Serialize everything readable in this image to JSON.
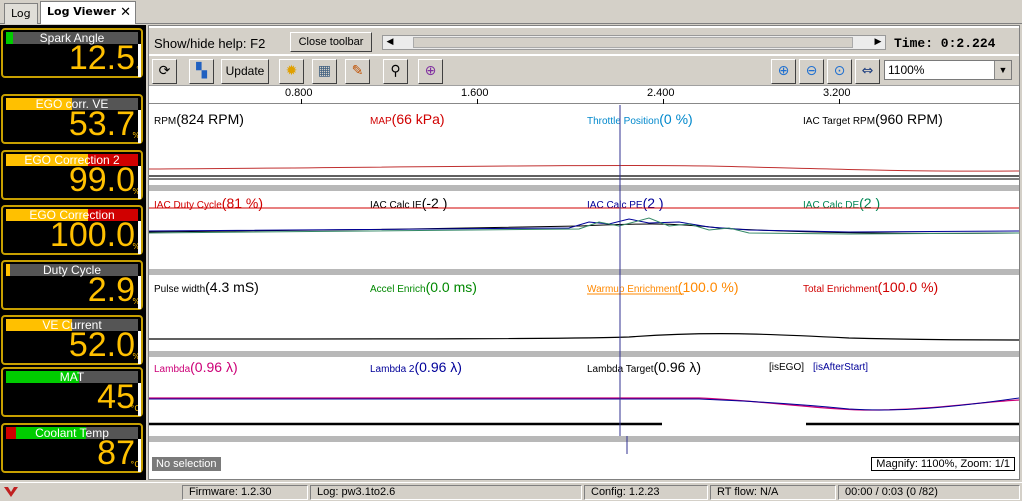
{
  "tabs": [
    {
      "label": "Log"
    },
    {
      "label": "Log Viewer",
      "close": "✕"
    }
  ],
  "gauges": [
    {
      "title": "Spark Angle",
      "value": "12.5",
      "unit": "°",
      "bar_color": "#00cc00",
      "bar_fill": 0.05
    },
    {
      "title": "EGO corr. VE",
      "value": "53.7",
      "unit": "%",
      "bar_color": "#ffc000",
      "bar_fill": 0.5
    },
    {
      "title": "EGO Correction 2",
      "value": "99.0",
      "unit": "%",
      "bar_color": "#ffc000",
      "bar_fill": 0.62
    },
    {
      "title": "EGO Correction",
      "value": "100.0",
      "unit": "%",
      "bar_color": "#ffc000",
      "bar_fill": 0.62
    },
    {
      "title": "Duty Cycle",
      "value": "2.9",
      "unit": "%",
      "bar_color": "#ffc000",
      "bar_fill": 0.03
    },
    {
      "title": "VE Current",
      "value": "52.0",
      "unit": "%",
      "bar_color": "#ffc000",
      "bar_fill": 0.5
    },
    {
      "title": "MAT",
      "value": "45",
      "unit": "°C",
      "bar_color": "#00cc00",
      "bar_fill": 0.55
    },
    {
      "title": "Coolant Temp",
      "value": "87",
      "unit": "°C",
      "bar_color": "#00cc00",
      "bar_fill": 0.6
    }
  ],
  "toolbar": {
    "help_text": "Show/hide help: F2",
    "close_toolbar": "Close toolbar",
    "time_text": "Time:  0:2.224",
    "update": "Update",
    "zoom_value": "1100%"
  },
  "ruler": {
    "ticks": [
      "0.800",
      "1.600",
      "2.400",
      "3.200"
    ]
  },
  "graphs": [
    {
      "labels": [
        {
          "name": "RPM",
          "value": "(824 RPM)",
          "color": "#000000"
        },
        {
          "name": "MAP",
          "value": "(66 kPa)",
          "color": "#d00000"
        },
        {
          "name": "Throttle Position",
          "value": "(0 %)",
          "color": "#0088cc"
        },
        {
          "name": "IAC Target RPM",
          "value": "(960 RPM)",
          "color": "#000000"
        }
      ]
    },
    {
      "labels": [
        {
          "name": "IAC Duty Cycle",
          "value": "(81 %)",
          "color": "#d00000"
        },
        {
          "name": "IAC Calc IE",
          "value": "(-2 )",
          "color": "#000000"
        },
        {
          "name": "IAC Calc PE",
          "value": "(2 )",
          "color": "#000099"
        },
        {
          "name": "IAC Calc DE",
          "value": "(2 )",
          "color": "#008855"
        }
      ]
    },
    {
      "labels": [
        {
          "name": "Pulse width",
          "value": "(4.3 mS)",
          "color": "#000000"
        },
        {
          "name": "Accel Enrich",
          "value": "(0.0 ms)",
          "color": "#008800"
        },
        {
          "name": "Warmup Enrichment",
          "value": "(100.0 %)",
          "color": "#ff8800"
        },
        {
          "name": "Total Enrichment",
          "value": "(100.0 %)",
          "color": "#d00000"
        }
      ]
    },
    {
      "labels": [
        {
          "name": "Lambda",
          "value": "(0.96 λ)",
          "color": "#cc0077"
        },
        {
          "name": "Lambda 2",
          "value": "(0.96 λ)",
          "color": "#000099"
        },
        {
          "name": "Lambda Target",
          "value": "(0.96 λ)",
          "color": "#000000"
        },
        {
          "name": "[isEGO]",
          "value": "",
          "color": "#000000"
        },
        {
          "name": "[isAfterStart]",
          "value": "",
          "color": "#000099"
        }
      ]
    }
  ],
  "no_selection": "No selection",
  "magnify": "Magnify: 1100%, Zoom: 1/1",
  "status": {
    "firmware": "Firmware: 1.2.30",
    "log": "Log: pw3.1to2.6",
    "config": "Config: 1.2.23",
    "rtflow": "RT flow: N/A",
    "time": "00:00 / 0:03 (0 /82)"
  }
}
